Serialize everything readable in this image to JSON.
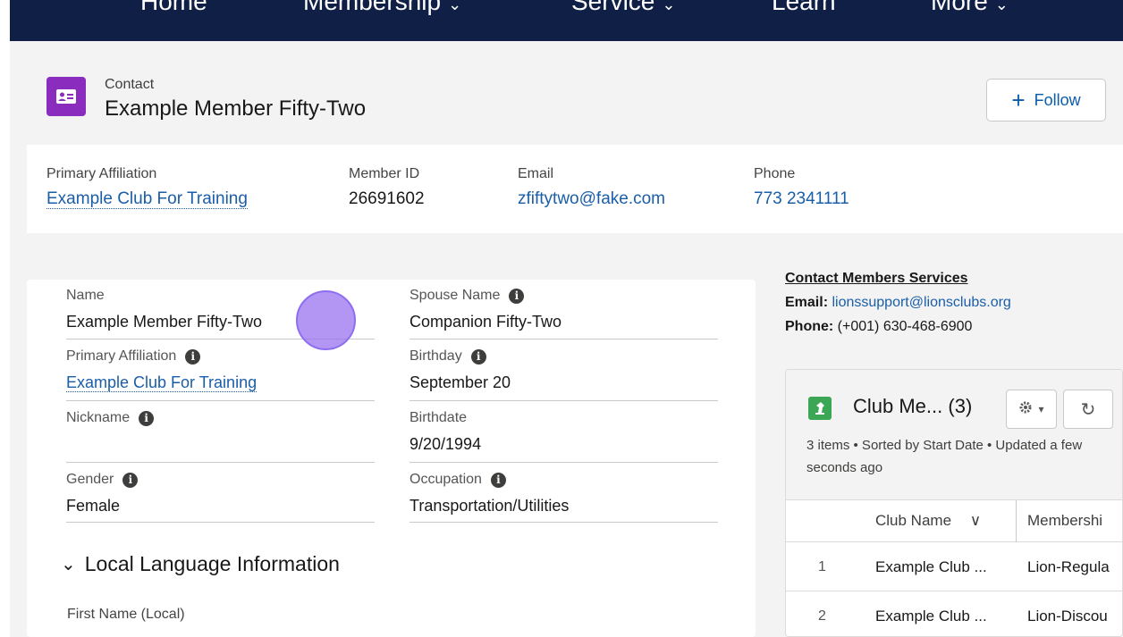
{
  "nav": {
    "items": [
      {
        "label": "Home",
        "has_dropdown": false
      },
      {
        "label": "Membership",
        "has_dropdown": true
      },
      {
        "label": "Service",
        "has_dropdown": true
      },
      {
        "label": "Learn",
        "has_dropdown": false
      },
      {
        "label": "More",
        "has_dropdown": true
      }
    ],
    "chevron": "⌄"
  },
  "header": {
    "object_type": "Contact",
    "title": "Example Member Fifty-Two",
    "icon": "contact-card-icon",
    "follow_label": "Follow",
    "follow_plus": "+"
  },
  "highlights": [
    {
      "label": "Primary Affiliation",
      "value": "Example Club For Training",
      "is_link": true
    },
    {
      "label": "Member ID",
      "value": "26691602",
      "is_link": false
    },
    {
      "label": "Email",
      "value": "zfiftytwo@fake.com",
      "is_link": true
    },
    {
      "label": "Phone",
      "value": "773 2341111",
      "is_link": true
    }
  ],
  "details": {
    "name": {
      "label": "Name",
      "value": "Example Member Fifty-Two"
    },
    "spouse_name": {
      "label": "Spouse Name",
      "value": "Companion Fifty-Two"
    },
    "primary_affiliation": {
      "label": "Primary Affiliation",
      "value": "Example Club For Training"
    },
    "birthday": {
      "label": "Birthday",
      "value": "September 20"
    },
    "nickname": {
      "label": "Nickname",
      "value": ""
    },
    "birthdate": {
      "label": "Birthdate",
      "value": "9/20/1994"
    },
    "gender": {
      "label": "Gender",
      "value": "Female"
    },
    "occupation": {
      "label": "Occupation",
      "value": "Transportation/Utilities"
    },
    "info_glyph": "i",
    "local_language_section": "Local Language Information",
    "section_chevron": "⌄",
    "first_name_local_label": "First Name (Local)"
  },
  "contact_services": {
    "title": "Contact Members Services",
    "email_label": "Email:",
    "email_value": "lionssupport@lionsclubs.org",
    "phone_label": "Phone:",
    "phone_value": "(+001) 630-468-6900"
  },
  "related_list": {
    "title": "Club Me...",
    "count": "(3)",
    "meta": "3 items • Sorted by Start Date • Updated a few seconds ago",
    "gear_caret": "▾",
    "refresh_glyph": "↻",
    "columns": [
      "Club Name",
      "Membershi"
    ],
    "sort_chevron": "∨",
    "rows": [
      {
        "num": "1",
        "club": "Example Club ...",
        "membership": "Lion-Regula"
      },
      {
        "num": "2",
        "club": "Example Club ...",
        "membership": "Lion-Discou"
      }
    ]
  },
  "colors": {
    "nav_bg": "#0f1f45",
    "contact_icon": "#8a2cbd",
    "related_icon": "#3ba755",
    "link": "#1a5ea8",
    "cursor_highlight": "#966ef0"
  }
}
